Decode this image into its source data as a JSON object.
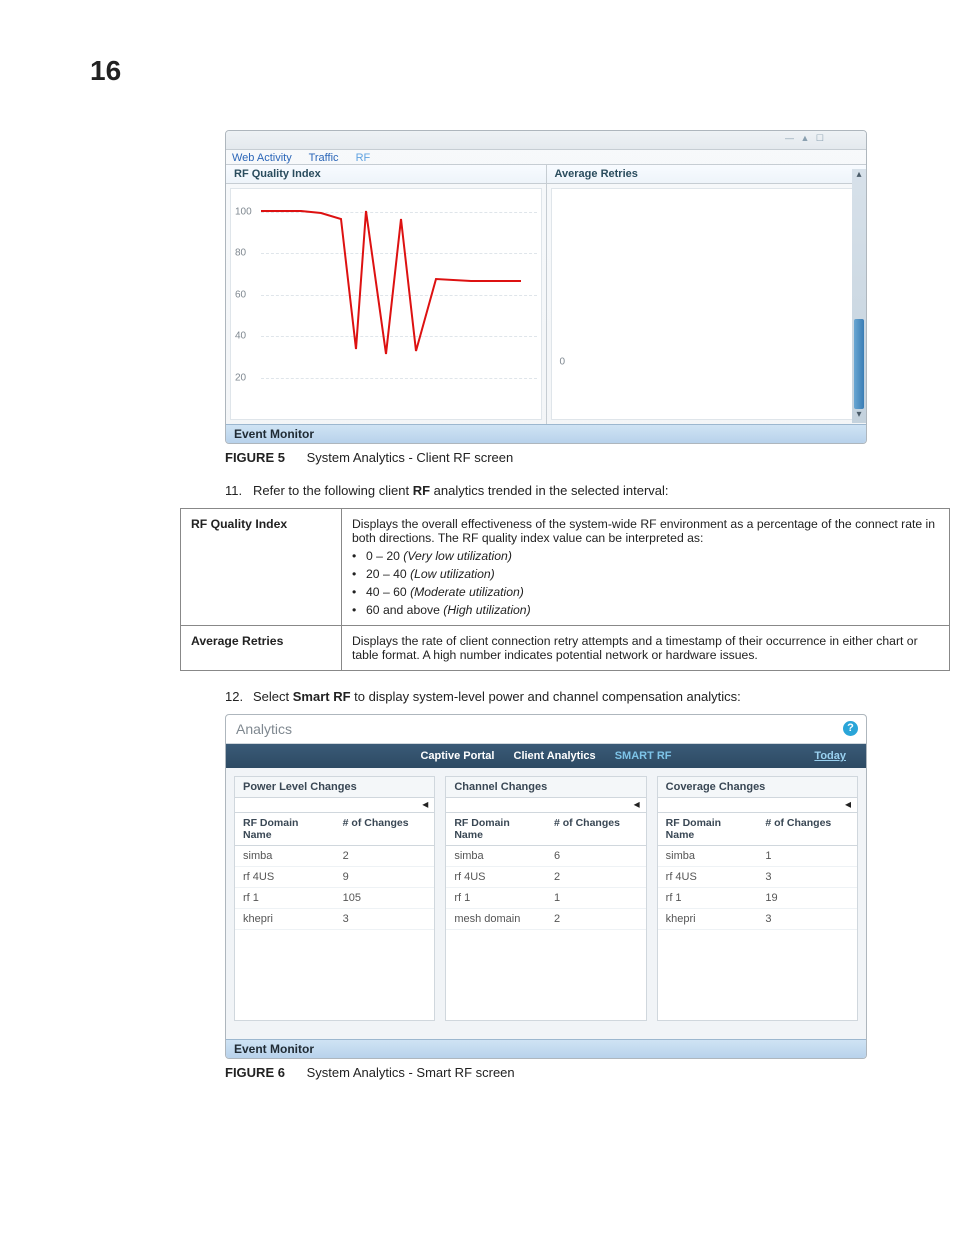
{
  "pageNumber": "16",
  "figure5": {
    "tabs": {
      "a": "Web Activity",
      "b": "Traffic",
      "c": "RF"
    },
    "chart1": {
      "title": "RF Quality Index",
      "yticks": [
        "100",
        "80",
        "60",
        "40",
        "20"
      ]
    },
    "chart2": {
      "title": "Average Retries",
      "zeroLabel": "0"
    },
    "eventMonitor": "Event Monitor",
    "captionLabel": "FIGURE 5",
    "captionText": "System Analytics - Client RF screen"
  },
  "chart_data": {
    "type": "line",
    "title": "RF Quality Index",
    "ylabel": "",
    "ylim": [
      0,
      100
    ],
    "yticks": [
      20,
      40,
      60,
      80,
      100
    ],
    "x": [
      0,
      1,
      2,
      3,
      4,
      5,
      6,
      7,
      8,
      9,
      10,
      11
    ],
    "values": [
      100,
      100,
      99,
      96,
      30,
      100,
      27,
      96,
      28,
      66,
      65,
      65
    ]
  },
  "step11": {
    "num": "11.",
    "textA": "Refer to the following client ",
    "bold": "RF",
    "textB": " analytics trended in the selected interval:"
  },
  "defTable": {
    "row1": {
      "term": "RF Quality Index",
      "desc": "Displays the overall effectiveness of the system-wide RF environment as a percentage of the connect rate in both directions. The RF quality index value can be interpreted as:",
      "b1a": "0 – 20 ",
      "b1b": "(Very low utilization)",
      "b2a": "20 – 40 ",
      "b2b": "(Low utilization)",
      "b3a": "40 – 60 ",
      "b3b": "(Moderate utilization)",
      "b4a": "60 and above ",
      "b4b": "(High utilization)"
    },
    "row2": {
      "term": "Average Retries",
      "desc": "Displays the rate of client connection retry attempts and a timestamp of their occurrence in either chart or table format. A high number indicates potential network or hardware issues."
    }
  },
  "step12": {
    "num": "12.",
    "textA": "Select ",
    "bold": "Smart RF",
    "textB": " to display system-level power and channel compensation analytics:"
  },
  "figure6": {
    "title": "Analytics",
    "tabs": {
      "a": "Captive Portal",
      "b": "Client Analytics",
      "c": "SMART RF"
    },
    "today": "Today",
    "hdr": {
      "c1": "RF Domain Name",
      "c2": "# of Changes"
    },
    "col1": {
      "title": "Power Level Changes",
      "rows": [
        {
          "n": "simba",
          "v": "2"
        },
        {
          "n": "rf 4US",
          "v": "9"
        },
        {
          "n": "rf 1",
          "v": "105"
        },
        {
          "n": "khepri",
          "v": "3"
        }
      ]
    },
    "col2": {
      "title": "Channel Changes",
      "rows": [
        {
          "n": "simba",
          "v": "6"
        },
        {
          "n": "rf 4US",
          "v": "2"
        },
        {
          "n": "rf 1",
          "v": "1"
        },
        {
          "n": "mesh domain",
          "v": "2"
        }
      ]
    },
    "col3": {
      "title": "Coverage Changes",
      "rows": [
        {
          "n": "simba",
          "v": "1"
        },
        {
          "n": "rf 4US",
          "v": "3"
        },
        {
          "n": "rf 1",
          "v": "19"
        },
        {
          "n": "khepri",
          "v": "3"
        }
      ]
    },
    "eventMonitor": "Event Monitor",
    "captionLabel": "FIGURE 6",
    "captionText": "System Analytics - Smart RF screen"
  }
}
